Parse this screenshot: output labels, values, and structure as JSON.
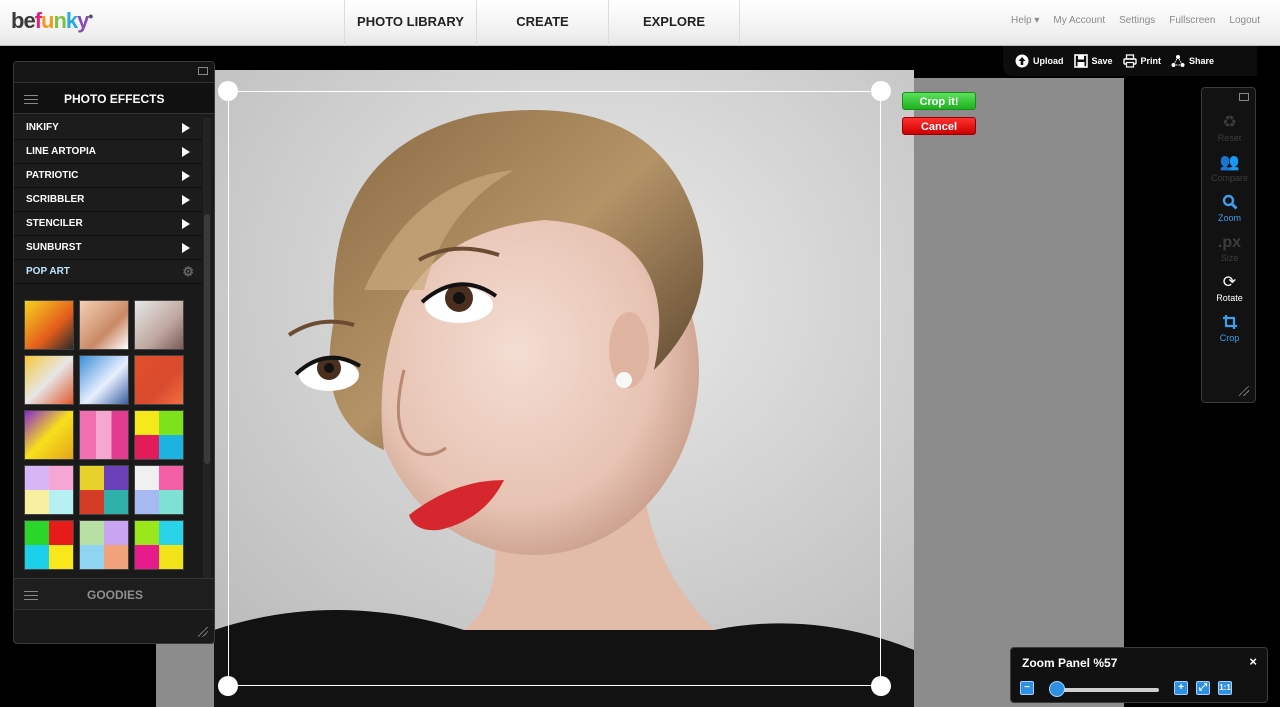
{
  "brand": {
    "logo_text_be": "be",
    "logo_text_f": "f",
    "logo_text_u": "u",
    "logo_text_n": "n",
    "logo_text_k": "k",
    "logo_text_y": "y",
    "logo_dot": "•"
  },
  "nav": {
    "tabs": [
      {
        "label": "PHOTO LIBRARY"
      },
      {
        "label": "CREATE"
      },
      {
        "label": "EXPLORE"
      }
    ]
  },
  "top_links": {
    "help": "Help ▾",
    "account": "My Account",
    "settings": "Settings",
    "fullscreen": "Fullscreen",
    "logout": "Logout"
  },
  "actions": {
    "upload": "Upload",
    "save": "Save",
    "print": "Print",
    "share": "Share"
  },
  "crop": {
    "confirm": "Crop it!",
    "cancel": "Cancel"
  },
  "effects_panel": {
    "title": "PHOTO EFFECTS",
    "items": [
      {
        "label": "INKIFY"
      },
      {
        "label": "LINE ARTOPIA"
      },
      {
        "label": "PATRIOTIC"
      },
      {
        "label": "SCRIBBLER"
      },
      {
        "label": "STENCILER"
      },
      {
        "label": "SUNBURST"
      },
      {
        "label": "POP ART"
      }
    ],
    "goodies": "GOODIES"
  },
  "tools": {
    "reset": "Reset",
    "compare": "Compare",
    "zoom": "Zoom",
    "size_icon": ".px",
    "size": "Size",
    "rotate": "Rotate",
    "crop": "Crop"
  },
  "zoom_panel": {
    "title": "Zoom Panel %57",
    "close": "×",
    "level_fraction": 0.0
  },
  "colors": {
    "accent_blue": "#2f8fe0",
    "crop_green": "#1fb01f",
    "cancel_red": "#cc0000"
  }
}
